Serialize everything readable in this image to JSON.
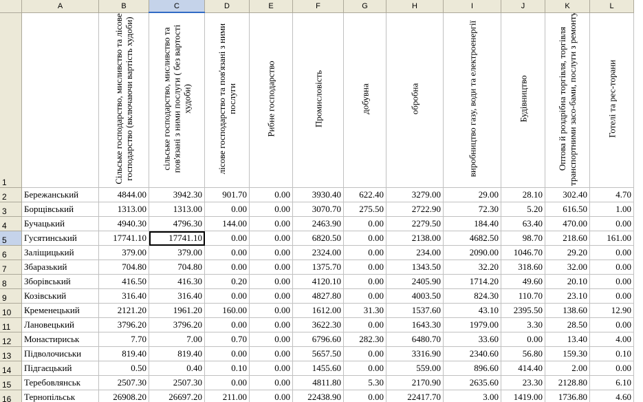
{
  "columns": [
    "A",
    "B",
    "C",
    "D",
    "E",
    "F",
    "G",
    "H",
    "I",
    "J",
    "K",
    "L"
  ],
  "selected_column": "C",
  "selected_row": "5",
  "header_row": {
    "row_label": "1",
    "B": "Сільське господарство, мисливство та лісове господарство (включаючи вартість худоби)",
    "C": "сільське господарство, мисливство та пов'язані з ними послуги ( без вартості худоби)",
    "D": "лісове господарство та пов'язані з ними послуги",
    "E": "Рибне господарство",
    "F": "Промисловість",
    "G": "добувна",
    "H": "обробна",
    "I": "виробництво газу, води та електроенергії",
    "J": "Будівництво",
    "K": "Оптова й роздрібна торгівля, торгівля транспортними засо-бами, послуги з ремонту",
    "L": "Готелі та рес-торани"
  },
  "rows": [
    {
      "n": "2",
      "name": "Бережанський",
      "v": [
        "4844.00",
        "3942.30",
        "901.70",
        "0.00",
        "3930.40",
        "622.40",
        "3279.00",
        "29.00",
        "28.10",
        "302.40",
        "4.70"
      ]
    },
    {
      "n": "3",
      "name": "Борщівський",
      "v": [
        "1313.00",
        "1313.00",
        "0.00",
        "0.00",
        "3070.70",
        "275.50",
        "2722.90",
        "72.30",
        "5.20",
        "616.50",
        "1.00"
      ]
    },
    {
      "n": "4",
      "name": "Бучацький",
      "v": [
        "4940.30",
        "4796.30",
        "144.00",
        "0.00",
        "2463.90",
        "0.00",
        "2279.50",
        "184.40",
        "63.40",
        "470.00",
        "0.00"
      ]
    },
    {
      "n": "5",
      "name": "Гусятинський",
      "v": [
        "17741.10",
        "17741.10",
        "0.00",
        "0.00",
        "6820.50",
        "0.00",
        "2138.00",
        "4682.50",
        "98.70",
        "218.60",
        "161.00"
      ]
    },
    {
      "n": "6",
      "name": "Заліщицький",
      "v": [
        "379.00",
        "379.00",
        "0.00",
        "0.00",
        "2324.00",
        "0.00",
        "234.00",
        "2090.00",
        "1046.70",
        "29.20",
        "0.00"
      ]
    },
    {
      "n": "7",
      "name": "Збаразький",
      "v": [
        "704.80",
        "704.80",
        "0.00",
        "0.00",
        "1375.70",
        "0.00",
        "1343.50",
        "32.20",
        "318.60",
        "32.00",
        "0.00"
      ]
    },
    {
      "n": "8",
      "name": "Зборівський",
      "v": [
        "416.50",
        "416.30",
        "0.20",
        "0.00",
        "4120.10",
        "0.00",
        "2405.90",
        "1714.20",
        "49.60",
        "20.10",
        "0.00"
      ]
    },
    {
      "n": "9",
      "name": "Козівський",
      "v": [
        "316.40",
        "316.40",
        "0.00",
        "0.00",
        "4827.80",
        "0.00",
        "4003.50",
        "824.30",
        "110.70",
        "23.10",
        "0.00"
      ]
    },
    {
      "n": "10",
      "name": "Кременецький",
      "v": [
        "2121.20",
        "1961.20",
        "160.00",
        "0.00",
        "1612.00",
        "31.30",
        "1537.60",
        "43.10",
        "2395.50",
        "138.60",
        "12.90"
      ]
    },
    {
      "n": "11",
      "name": "Лановецький",
      "v": [
        "3796.20",
        "3796.20",
        "0.00",
        "0.00",
        "3622.30",
        "0.00",
        "1643.30",
        "1979.00",
        "3.30",
        "28.50",
        "0.00"
      ]
    },
    {
      "n": "12",
      "name": "Монастириськ",
      "v": [
        "7.70",
        "7.00",
        "0.70",
        "0.00",
        "6796.60",
        "282.30",
        "6480.70",
        "33.60",
        "0.00",
        "13.40",
        "4.00"
      ]
    },
    {
      "n": "13",
      "name": "Підволочиськи",
      "v": [
        "819.40",
        "819.40",
        "0.00",
        "0.00",
        "5657.50",
        "0.00",
        "3316.90",
        "2340.60",
        "56.80",
        "159.30",
        "0.10"
      ]
    },
    {
      "n": "14",
      "name": "Підгаєцький",
      "v": [
        "0.50",
        "0.40",
        "0.10",
        "0.00",
        "1455.60",
        "0.00",
        "559.00",
        "896.60",
        "414.40",
        "2.00",
        "0.00"
      ]
    },
    {
      "n": "15",
      "name": "Теребовлянськ",
      "v": [
        "2507.30",
        "2507.30",
        "0.00",
        "0.00",
        "4811.80",
        "5.30",
        "2170.90",
        "2635.60",
        "23.30",
        "2128.80",
        "6.10"
      ]
    },
    {
      "n": "16",
      "name": "Тернопільськ",
      "v": [
        "26908.20",
        "26697.20",
        "211.00",
        "0.00",
        "22438.90",
        "0.00",
        "22417.70",
        "3.00",
        "1419.00",
        "1736.80",
        "4.60"
      ]
    }
  ]
}
